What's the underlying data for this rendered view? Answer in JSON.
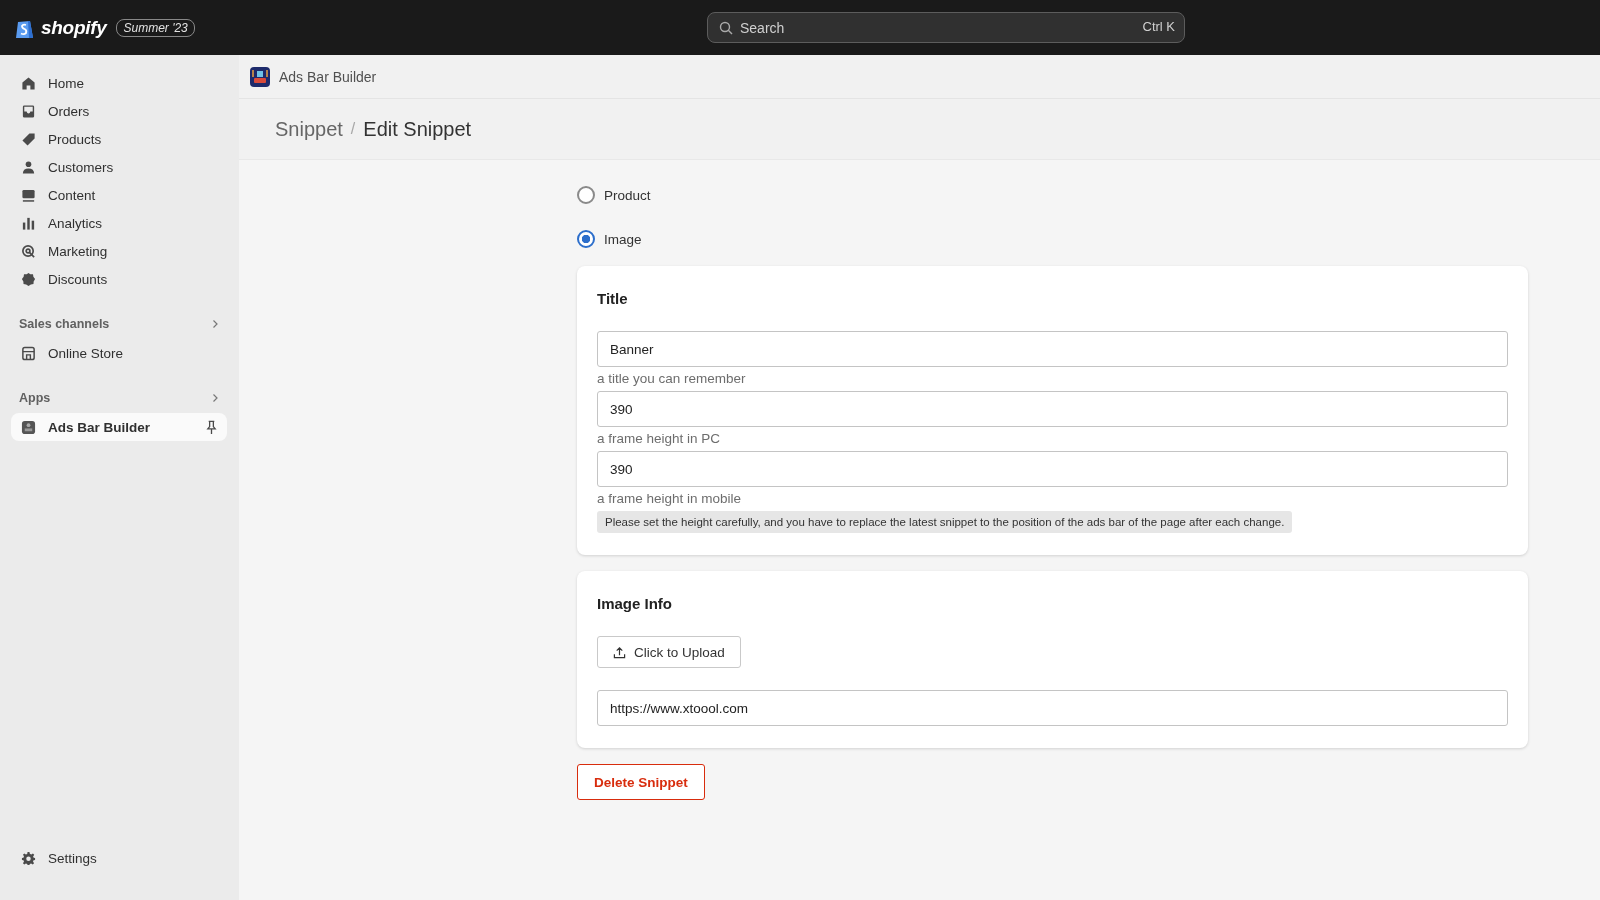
{
  "topbar": {
    "logo": "shopify",
    "edition": "Summer '23",
    "search": {
      "placeholder": "Search",
      "shortcut": "Ctrl K"
    }
  },
  "sidebar": {
    "items": [
      {
        "label": "Home",
        "selected": false
      },
      {
        "label": "Orders",
        "selected": false
      },
      {
        "label": "Products",
        "selected": false
      },
      {
        "label": "Customers",
        "selected": false
      },
      {
        "label": "Content",
        "selected": false
      },
      {
        "label": "Analytics",
        "selected": false
      },
      {
        "label": "Marketing",
        "selected": false
      },
      {
        "label": "Discounts",
        "selected": false
      }
    ],
    "sections": [
      {
        "title": "Sales channels",
        "items": [
          {
            "label": "Online Store",
            "selected": false
          }
        ]
      },
      {
        "title": "Apps",
        "items": [
          {
            "label": "Ads Bar Builder",
            "selected": true
          }
        ]
      }
    ],
    "settings": "Settings"
  },
  "app_header": {
    "title": "Ads Bar Builder"
  },
  "breadcrumb": {
    "parent": "Snippet",
    "separator": "/",
    "current": "Edit Snippet"
  },
  "type_options": [
    {
      "label": "Product",
      "selected": false
    },
    {
      "label": "Image",
      "selected": true
    }
  ],
  "title_card": {
    "heading": "Title",
    "fields": [
      {
        "value": "Banner",
        "hint": "a title you can remember"
      },
      {
        "value": "390",
        "hint": "a frame height in PC"
      },
      {
        "value": "390",
        "hint": "a frame height in mobile"
      }
    ],
    "notice": "Please set the height carefully, and you have to replace the latest snippet to the position of the ads bar of the page after each change."
  },
  "image_card": {
    "heading": "Image Info",
    "upload_button": "Click to Upload",
    "url": "https://www.xtoool.com"
  },
  "delete_button": "Delete Snippet"
}
